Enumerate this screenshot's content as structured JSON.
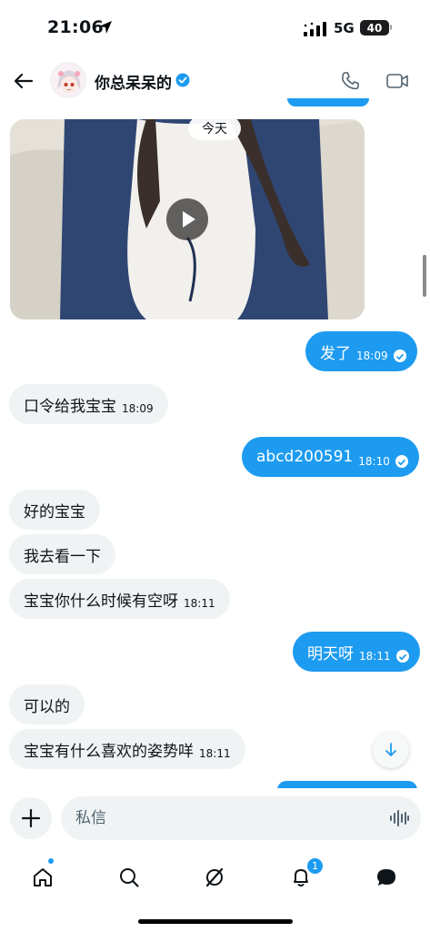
{
  "status_bar": {
    "time": "21:06",
    "network": "5G",
    "battery": "40"
  },
  "header": {
    "contact_name": "你总呆呆的"
  },
  "video": {
    "date_label": "今天"
  },
  "messages": [
    {
      "side": "out",
      "text": "发了",
      "time": "18:09",
      "read": true
    },
    {
      "side": "in",
      "text": "口令给我宝宝",
      "time": "18:09"
    },
    {
      "side": "out",
      "text": "abcd200591",
      "time": "18:10",
      "read": true
    },
    {
      "side": "in",
      "text": "好的宝宝",
      "time": ""
    },
    {
      "side": "in",
      "text": "我去看一下",
      "time": ""
    },
    {
      "side": "in",
      "text": "宝宝你什么时候有空呀",
      "time": "18:11"
    },
    {
      "side": "out",
      "text": "明天呀",
      "time": "18:11",
      "read": true
    },
    {
      "side": "in",
      "text": "可以的",
      "time": ""
    },
    {
      "side": "in",
      "text": "宝宝有什么喜欢的姿势咩",
      "time": "18:11"
    }
  ],
  "composer": {
    "placeholder": "私信"
  },
  "tabbar": {
    "notifications_count": "1"
  },
  "colors": {
    "accent": "#1d9bf0",
    "incoming_bubble": "#eff3f4"
  }
}
